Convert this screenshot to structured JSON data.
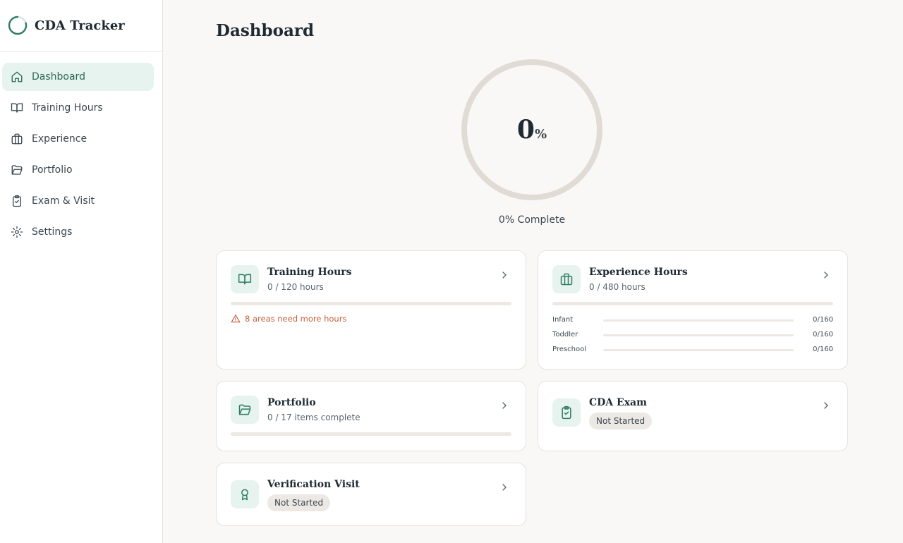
{
  "app": {
    "name": "CDA Tracker"
  },
  "nav": {
    "items": [
      {
        "label": "Dashboard",
        "icon": "home-icon",
        "active": true
      },
      {
        "label": "Training Hours",
        "icon": "book-icon"
      },
      {
        "label": "Experience",
        "icon": "briefcase-icon"
      },
      {
        "label": "Portfolio",
        "icon": "folder-icon"
      },
      {
        "label": "Exam & Visit",
        "icon": "clipboard-check-icon"
      },
      {
        "label": "Settings",
        "icon": "gear-icon"
      }
    ]
  },
  "page": {
    "title": "Dashboard"
  },
  "progress": {
    "value": "0",
    "unit": "%",
    "percent": 0,
    "label": "0% Complete"
  },
  "cards": {
    "training": {
      "title": "Training Hours",
      "subtitle": "0 / 120 hours",
      "progress": 0,
      "warning": "8 areas need more hours"
    },
    "experience": {
      "title": "Experience Hours",
      "subtitle": "0 / 480 hours",
      "progress": 0,
      "rows": [
        {
          "name": "Infant",
          "value": "0/160",
          "progress": 0
        },
        {
          "name": "Toddler",
          "value": "0/160",
          "progress": 0
        },
        {
          "name": "Preschool",
          "value": "0/160",
          "progress": 0
        }
      ]
    },
    "portfolio": {
      "title": "Portfolio",
      "subtitle": "0 / 17 items complete",
      "progress": 0
    },
    "exam": {
      "title": "CDA Exam",
      "status": "Not Started"
    },
    "visit": {
      "title": "Verification Visit",
      "status": "Not Started"
    }
  },
  "colors": {
    "accent": "#2f7d63",
    "accent_soft": "#e6f3ee",
    "track": "#ece9e4",
    "warning": "#c8603d"
  }
}
